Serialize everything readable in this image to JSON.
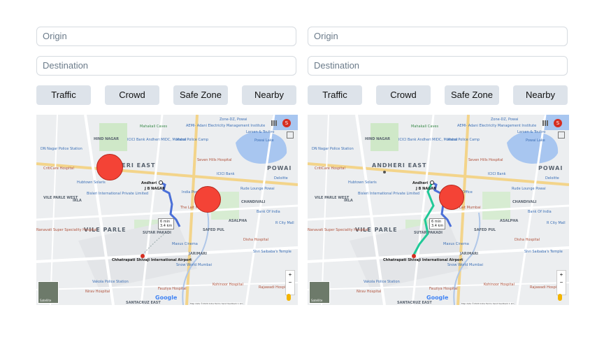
{
  "panels": [
    {
      "origin_placeholder": "Origin",
      "destination_placeholder": "Destination",
      "buttons": [
        "Traffic",
        "Crowd",
        "Safe Zone",
        "Nearby"
      ]
    },
    {
      "origin_placeholder": "Origin",
      "destination_placeholder": "Destination",
      "buttons": [
        "Traffic",
        "Crowd",
        "Safe Zone",
        "Nearby"
      ]
    }
  ],
  "map": {
    "areas": [
      "ANDHERI EAST",
      "POWAI",
      "VILE PARLE",
      "J B NAGAR",
      "CHANDIVALI",
      "SAFED PUL",
      "ASALPHA",
      "SUTAR PAKADI",
      "JARIMARI",
      "IRLA",
      "VILE PARLE WEST",
      "HIND NAGAR",
      "SANTACRUZ EAST"
    ],
    "pois": {
      "mahakali": "Mahakali Caves",
      "aemi": "AEMI- Adani Electricity Management Institute",
      "icici": "ICICI Bank Andheri MIDC, Mumbai",
      "dn_police": "DN Nagar Police Station",
      "andheri": "Andheri",
      "criticare": "CritiCare Hospital",
      "hubtown": "Hubtown Solaris",
      "bisleri": "Bisleri International Private Limited",
      "airport": "Chhatrapati Shivaji International Airport",
      "maroi": "Marol Police Camp",
      "sevenhills": "Seven Hills Hospital",
      "powai_lake": "Powai Lake",
      "rude_lounge": "Rude Lounge Powai",
      "deloitte": "Deloitte",
      "bank_of_india": "Bank Of India",
      "rcity": "R City Mall",
      "disha": "Disha Hospital",
      "marcus": "Maxus Cinema",
      "snow_world": "Snow World Mumbai",
      "nanavati": "Nanavati Super Speciality Hospital",
      "vakola": "Vakola Police Station",
      "nirav": "Nirav Hospital",
      "fauziya": "Fauziya Hospital",
      "kohinoor": "Kohinoor Hospital",
      "rajawadi": "Rajawadi Hospital",
      "shri_sai": "Shri Saibaba's Temple",
      "larsen": "Larsen & Toubro",
      "lake_office": "Lake Office",
      "zone": "Zone-DZ, Powai",
      "india_post": "India Post Office",
      "lait": "The Lait Mumbai",
      "sbi": "ICICI Bank",
      "powai_label": "Powai"
    },
    "eta_time": "6 min",
    "eta_dist": "3.4 km",
    "google": "Google",
    "satellite": "Satellite",
    "footer": "Map data ©2020   India   Terms   Send feedback   1 km",
    "badge": "S"
  },
  "colors": {
    "crowd_circle": "#f44336",
    "route_blue": "#4a6fd8",
    "route_green": "#20c997"
  }
}
